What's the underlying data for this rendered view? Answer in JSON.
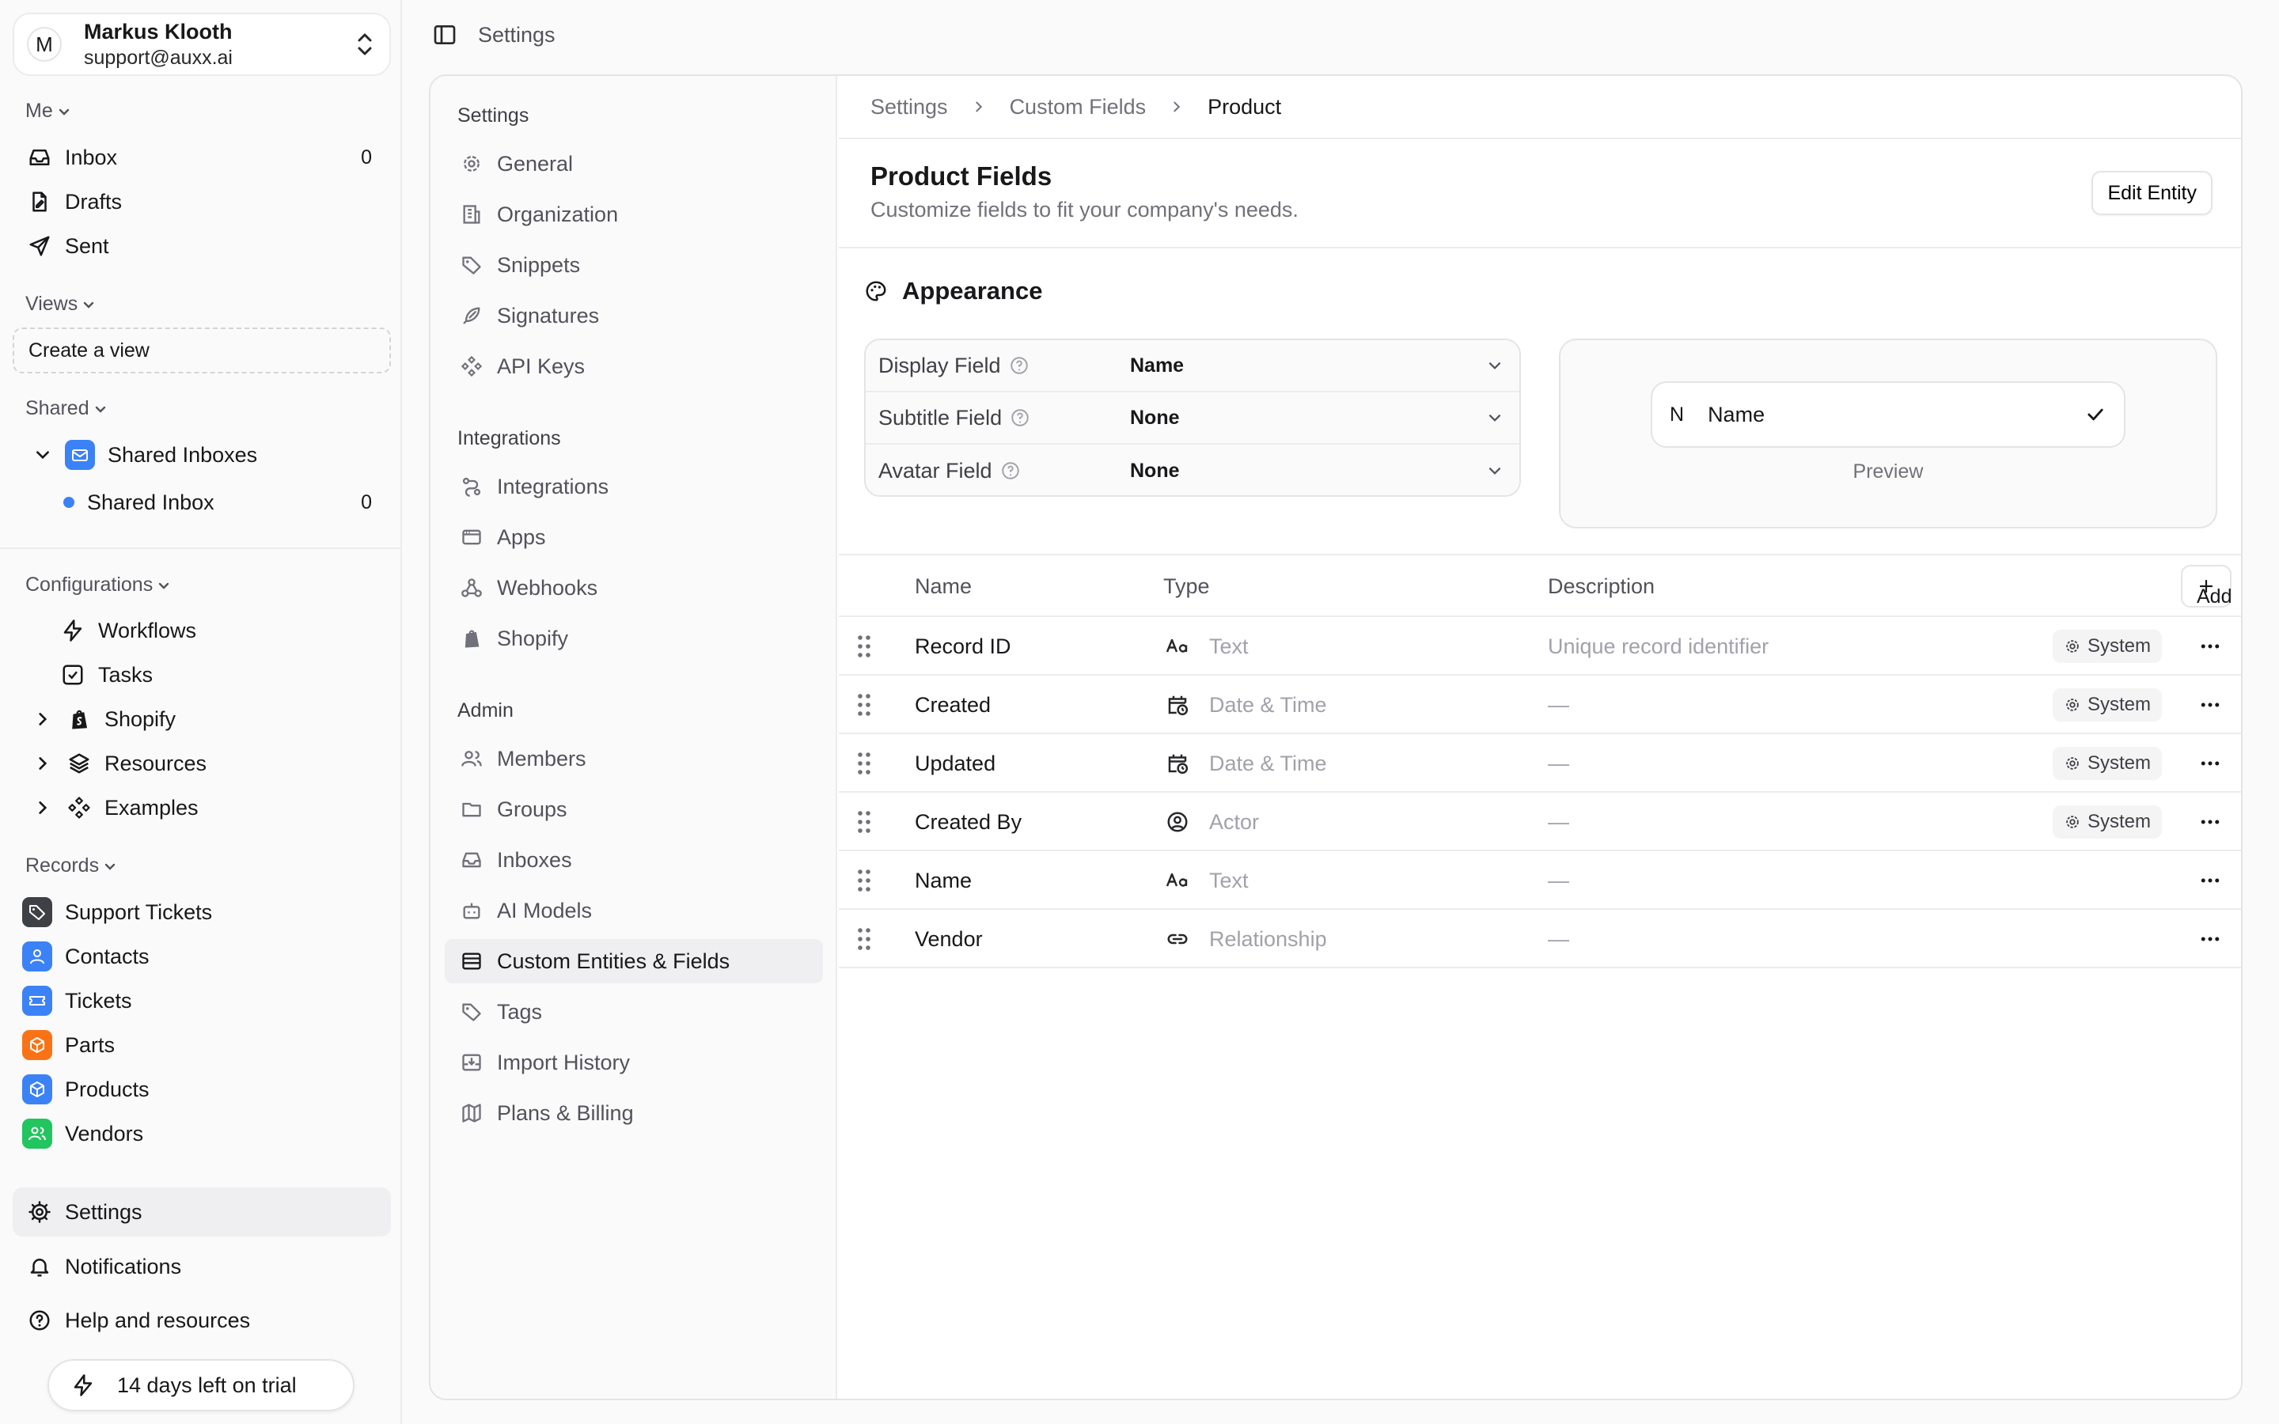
{
  "user": {
    "initial": "M",
    "name": "Markus Klooth",
    "email": "support@auxx.ai"
  },
  "sidebar": {
    "me_label": "Me",
    "me_items": [
      {
        "label": "Inbox",
        "count": "0"
      },
      {
        "label": "Drafts"
      },
      {
        "label": "Sent"
      }
    ],
    "views_label": "Views",
    "create_view": "Create a view",
    "shared_label": "Shared",
    "shared_group": "Shared Inboxes",
    "shared_inbox": {
      "label": "Shared Inbox",
      "count": "0"
    },
    "config_label": "Configurations",
    "config_items": [
      "Workflows",
      "Tasks",
      "Shopify",
      "Resources",
      "Examples"
    ],
    "records_label": "Records",
    "records": [
      {
        "label": "Support Tickets",
        "color": "#3f3f46"
      },
      {
        "label": "Contacts",
        "color": "#3b82f6"
      },
      {
        "label": "Tickets",
        "color": "#3b82f6"
      },
      {
        "label": "Parts",
        "color": "#f97316"
      },
      {
        "label": "Products",
        "color": "#3b82f6"
      },
      {
        "label": "Vendors",
        "color": "#22c55e"
      }
    ],
    "bottom": [
      "Settings",
      "Notifications",
      "Help and resources"
    ],
    "trial": "14 days left on trial"
  },
  "topbar": {
    "title": "Settings"
  },
  "settings_nav": {
    "settings_label": "Settings",
    "settings_items": [
      "General",
      "Organization",
      "Snippets",
      "Signatures",
      "API Keys"
    ],
    "integrations_label": "Integrations",
    "integrations_items": [
      "Integrations",
      "Apps",
      "Webhooks",
      "Shopify"
    ],
    "admin_label": "Admin",
    "admin_items": [
      "Members",
      "Groups",
      "Inboxes",
      "AI Models",
      "Custom Entities & Fields",
      "Tags",
      "Import History",
      "Plans & Billing"
    ]
  },
  "breadcrumb": [
    "Settings",
    "Custom Fields",
    "Product"
  ],
  "page": {
    "title": "Product Fields",
    "subtitle": "Customize fields to fit your company's needs.",
    "edit_button": "Edit Entity"
  },
  "appearance": {
    "title": "Appearance",
    "fields": [
      {
        "label": "Display Field",
        "value": "Name"
      },
      {
        "label": "Subtitle Field",
        "value": "None"
      },
      {
        "label": "Avatar Field",
        "value": "None"
      }
    ],
    "preview": {
      "initial": "N",
      "name": "Name",
      "label": "Preview"
    }
  },
  "table": {
    "headers": {
      "name": "Name",
      "type": "Type",
      "description": "Description"
    },
    "add_button": "Add",
    "rows": [
      {
        "name": "Record ID",
        "type": "Text",
        "type_icon": "text-icon",
        "description": "Unique record identifier",
        "badge": "System"
      },
      {
        "name": "Created",
        "type": "Date & Time",
        "type_icon": "calendar-clock-icon",
        "description": "—",
        "badge": "System"
      },
      {
        "name": "Updated",
        "type": "Date & Time",
        "type_icon": "calendar-clock-icon",
        "description": "—",
        "badge": "System"
      },
      {
        "name": "Created By",
        "type": "Actor",
        "type_icon": "user-circle-icon",
        "description": "—",
        "badge": "System"
      },
      {
        "name": "Name",
        "type": "Text",
        "type_icon": "text-icon",
        "description": "—",
        "badge": ""
      },
      {
        "name": "Vendor",
        "type": "Relationship",
        "type_icon": "link-icon",
        "description": "—",
        "badge": ""
      }
    ]
  }
}
